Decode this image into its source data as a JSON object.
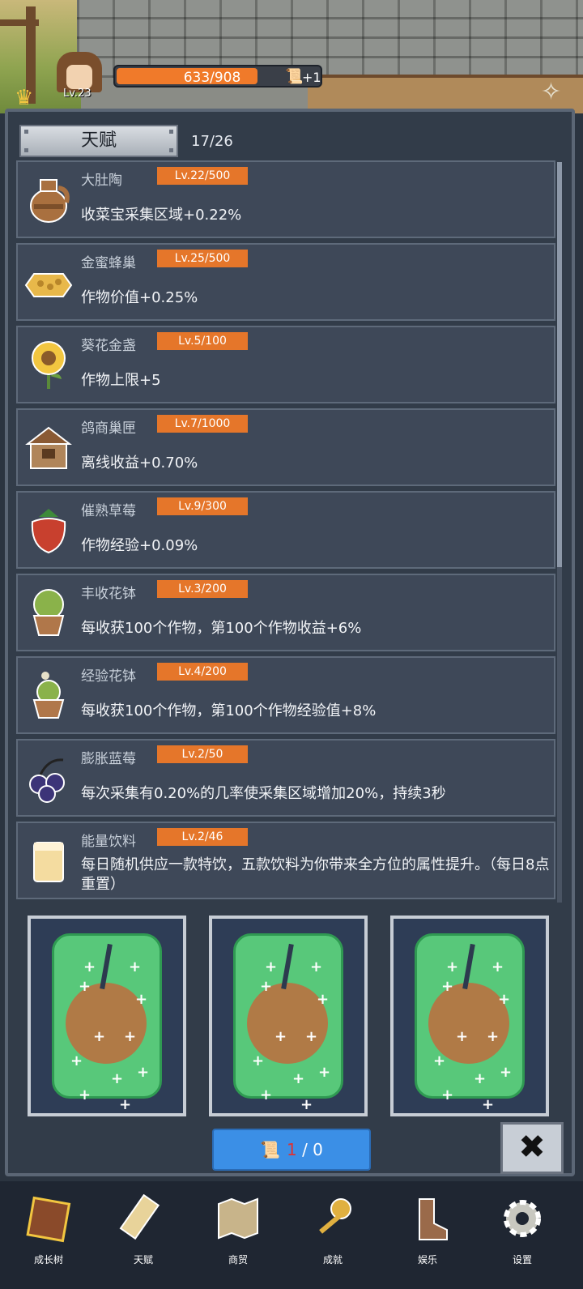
{
  "player": {
    "level": "Lv.23",
    "xp_text": "633/908",
    "xp_fraction": 0.697,
    "scroll_bonus": "+1"
  },
  "panel": {
    "tab_label": "天赋",
    "count": "17/26"
  },
  "talents": [
    {
      "name": "大肚陶",
      "level": "Lv.22/500",
      "desc": "收菜宝采集区域+0.22%",
      "icon": "jar-icon"
    },
    {
      "name": "金蜜蜂巢",
      "level": "Lv.25/500",
      "desc": "作物价值+0.25%",
      "icon": "honeycomb-icon"
    },
    {
      "name": "葵花金盏",
      "level": "Lv.5/100",
      "desc": "作物上限+5",
      "icon": "sunflower-icon"
    },
    {
      "name": "鸽商巢匣",
      "level": "Lv.7/1000",
      "desc": "离线收益+0.70%",
      "icon": "birdhouse-icon"
    },
    {
      "name": "催熟草莓",
      "level": "Lv.9/300",
      "desc": "作物经验+0.09%",
      "icon": "strawberry-icon"
    },
    {
      "name": "丰收花钵",
      "level": "Lv.3/200",
      "desc": "每收获100个作物，第100个作物收益+6%",
      "icon": "flowerpot-icon"
    },
    {
      "name": "经验花钵",
      "level": "Lv.4/200",
      "desc": "每收获100个作物，第100个作物经验值+8%",
      "icon": "sprout-pot-icon"
    },
    {
      "name": "膨胀蓝莓",
      "level": "Lv.2/50",
      "desc": "每次采集有0.20%的几率使采集区域增加20%，持续3秒",
      "icon": "blueberry-icon"
    },
    {
      "name": "能量饮料",
      "level": "Lv.2/46",
      "desc": "每日随机供应一款特饮，五款饮料为你带来全方位的属性提升。（每日8点重置）",
      "icon": "drink-icon"
    }
  ],
  "draw": {
    "current": "1",
    "separator": " / ",
    "total": "0"
  },
  "nav": [
    {
      "label": "成长树",
      "icon": "book-icon"
    },
    {
      "label": "天赋",
      "icon": "scroll-icon"
    },
    {
      "label": "商贸",
      "icon": "map-icon"
    },
    {
      "label": "成就",
      "icon": "key-icon"
    },
    {
      "label": "娱乐",
      "icon": "boot-icon"
    },
    {
      "label": "设置",
      "icon": "gear-icon"
    }
  ],
  "colors": {
    "accent_orange": "#e5762a",
    "button_blue": "#3b8fe6",
    "panel": "#323c49",
    "card_green": "#58c87a"
  }
}
